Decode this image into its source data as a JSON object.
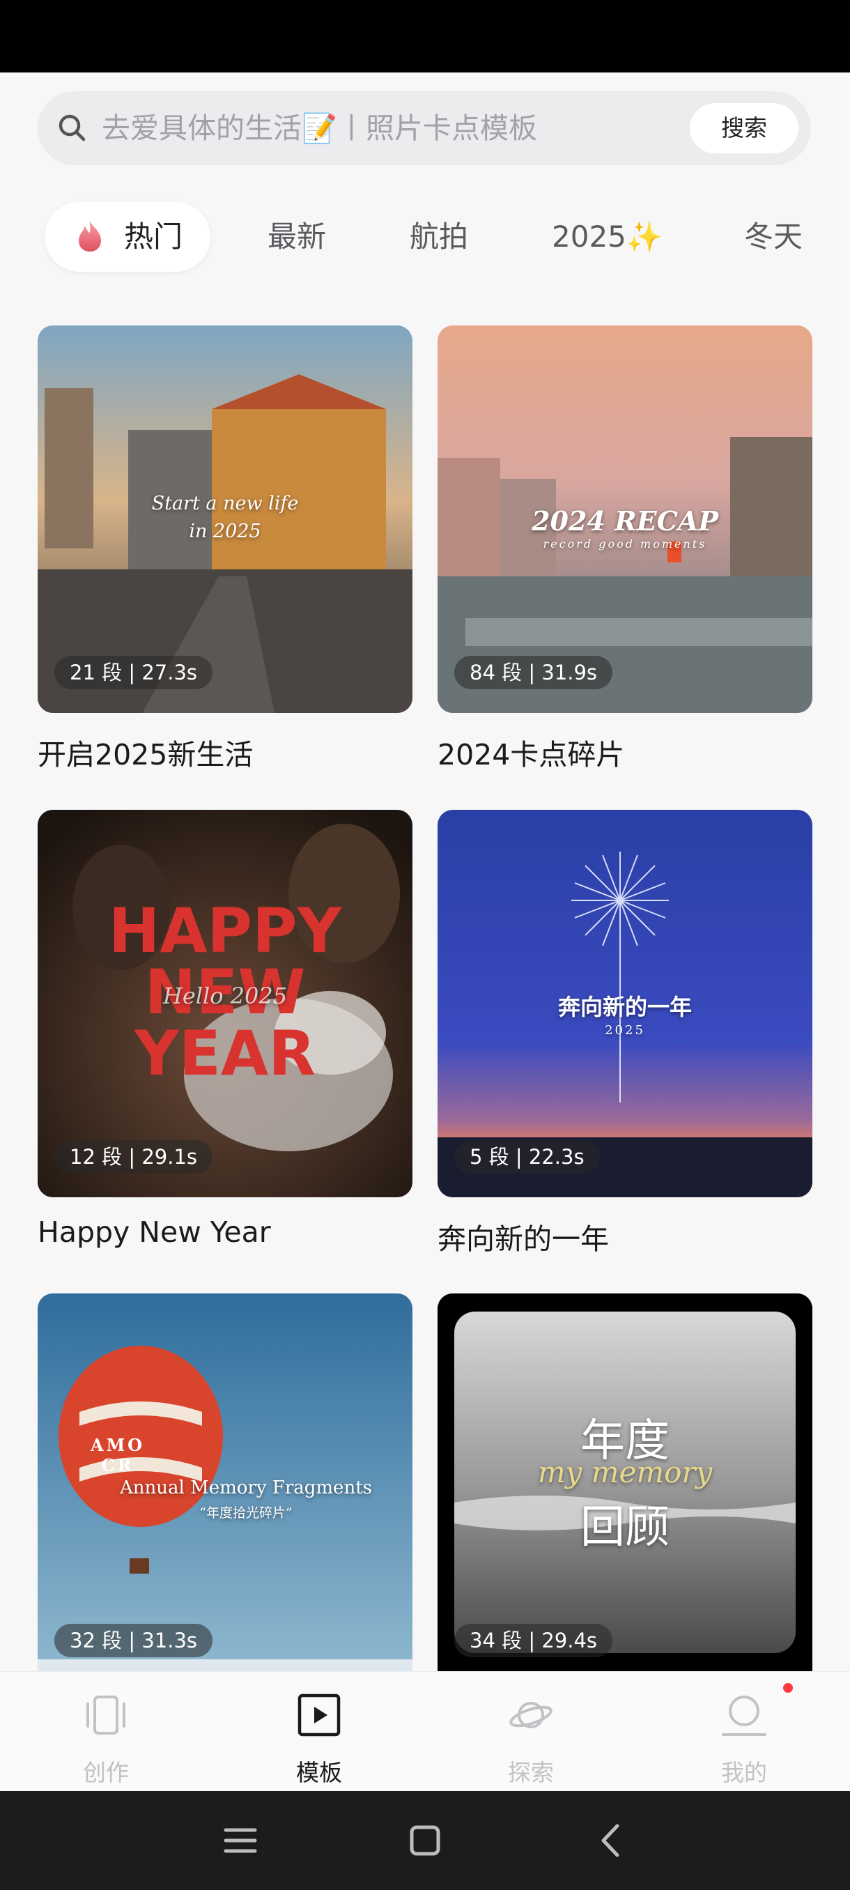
{
  "search": {
    "placeholder": "去爱具体的生活📝丨照片卡点模板",
    "button_label": "搜索"
  },
  "tabs": [
    {
      "label": "热门",
      "active": true,
      "icon": "flame-icon"
    },
    {
      "label": "最新"
    },
    {
      "label": "航拍"
    },
    {
      "label": "2025✨"
    },
    {
      "label": "冬天"
    }
  ],
  "templates": [
    {
      "title": "开启2025新生活",
      "meta": "21 段 | 27.3s",
      "overlay": [
        "Start a new life",
        "in 2025"
      ]
    },
    {
      "title": "2024卡点碎片",
      "meta": "84 段 | 31.9s",
      "overlay": [
        "2024 RECAP",
        "record good moments"
      ]
    },
    {
      "title": "Happy New Year",
      "meta": "12 段 | 29.1s",
      "overlay": [
        "HAPPY",
        "NEW",
        "YEAR",
        "Hello 2025"
      ]
    },
    {
      "title": "奔向新的一年",
      "meta": "5 段 | 22.3s",
      "overlay": [
        "奔向新的一年",
        "2025"
      ]
    },
    {
      "title": "",
      "meta": "32 段 | 31.3s",
      "overlay": [
        "Annual Memory Fragments",
        "“年度拾光碎片”",
        "AMO CR"
      ]
    },
    {
      "title": "",
      "meta": "34 段 | 29.4s",
      "overlay": [
        "年度",
        "回顾",
        "my memory"
      ]
    }
  ],
  "bottom_nav": [
    {
      "label": "创作",
      "icon": "phone-frame-icon"
    },
    {
      "label": "模板",
      "icon": "play-square-icon",
      "active": true
    },
    {
      "label": "探索",
      "icon": "planet-icon"
    },
    {
      "label": "我的",
      "icon": "profile-icon",
      "badge": true
    }
  ],
  "colors": {
    "accent_badge": "#ff3b3b",
    "active_text": "#1a1a1a",
    "inactive_text": "#c2c2c6"
  }
}
